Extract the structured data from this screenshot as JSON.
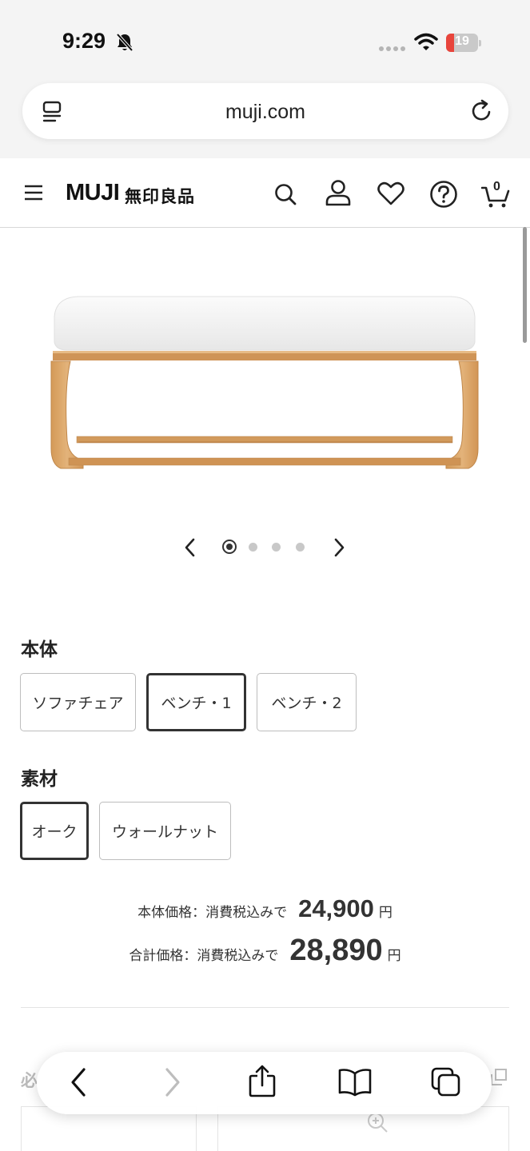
{
  "status_bar": {
    "time": "9:29",
    "battery_level": "19",
    "icons": [
      "bell-slash-icon",
      "signal-icon",
      "wifi-icon",
      "battery-icon"
    ]
  },
  "browser": {
    "url": "muji.com",
    "icons": [
      "reader-mode-icon",
      "reload-icon"
    ]
  },
  "site_header": {
    "logo": "MUJI",
    "logo_jp": "無印良品",
    "cart_count": "0",
    "icons": [
      "menu-icon",
      "search-icon",
      "account-icon",
      "heart-icon",
      "help-icon",
      "cart-icon"
    ]
  },
  "gallery": {
    "image": "bench-photo",
    "current_slide": 1,
    "total_slides": 4,
    "icons": [
      "chevron-left-icon",
      "chevron-right-icon"
    ]
  },
  "body_option": {
    "title": "本体",
    "options": [
      "ソファチェア",
      "ベンチ・1",
      "ベンチ・2"
    ],
    "selected_index": 1
  },
  "material_option": {
    "title": "素材",
    "options": [
      "オーク",
      "ウォールナット"
    ],
    "selected_index": 0
  },
  "price": {
    "body_label": "本体価格：消費税込みで",
    "body_value": "24,900",
    "total_label": "合計価格：消費税込みで",
    "total_value": "28,890",
    "currency": "円"
  },
  "peek": {
    "label": "必"
  },
  "toolbar": {
    "icons": [
      "back-icon",
      "forward-icon",
      "share-icon",
      "bookmarks-icon",
      "tabs-icon"
    ]
  },
  "colors": {
    "wood": "#d9a264",
    "cushion": "#f2f2f2",
    "text": "#222222",
    "battery_low": "#e8453c"
  }
}
